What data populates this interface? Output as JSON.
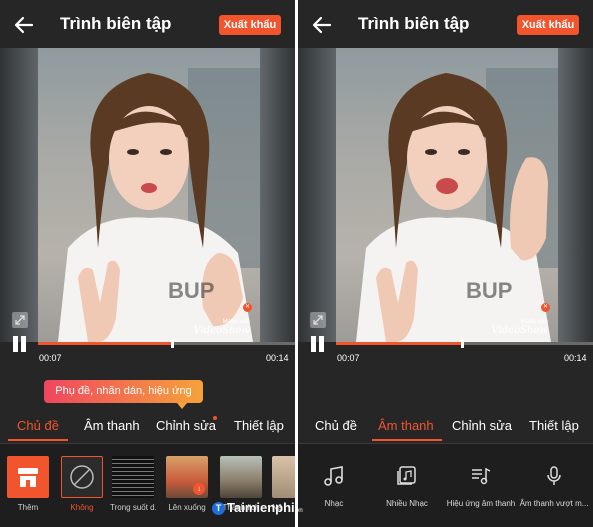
{
  "header": {
    "title": "Trình biên tập",
    "export_label": "Xuất khẩu"
  },
  "video": {
    "watermark_top": "Made with",
    "watermark_brand": "VideoShow",
    "elapsed": "00:07",
    "duration": "00:14",
    "progress_left_pct": 52,
    "progress_right_pct": 49
  },
  "tooltip": "Phụ đề, nhãn dán, hiệu ứng",
  "tabs": [
    {
      "label": "Chủ đề"
    },
    {
      "label": "Âm thanh"
    },
    {
      "label": "Chỉnh sửa"
    },
    {
      "label": "Thiết lập"
    }
  ],
  "themes": [
    {
      "label": "Thêm"
    },
    {
      "label": "Không"
    },
    {
      "label": "Trong suốt d..."
    },
    {
      "label": "Lên xuống"
    },
    {
      "label": "Thanh lịch"
    },
    {
      "label": "Nă"
    }
  ],
  "audio_tools": [
    {
      "label": "Nhạc",
      "icon": "music-note-icon"
    },
    {
      "label": "Nhiều Nhạc",
      "icon": "multi-music-icon"
    },
    {
      "label": "Hiệu ứng âm thanh",
      "icon": "sound-effect-icon"
    },
    {
      "label": "Âm thanh vượt m...",
      "icon": "microphone-icon"
    }
  ],
  "brand": {
    "name": "Taimienphi",
    "suffix": ".vn"
  },
  "colors": {
    "accent": "#f2552e",
    "background": "#262626",
    "bottom_bar": "#1e1e1e"
  }
}
